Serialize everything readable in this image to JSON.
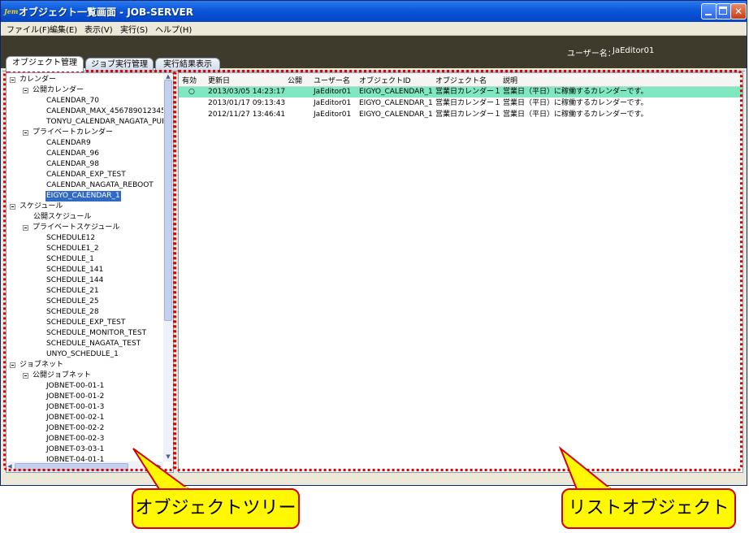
{
  "window": {
    "app_icon": "Jem",
    "title": "オブジェクト一覧画面 - JOB-SERVER"
  },
  "menu": [
    "ファイル(F)",
    "編集(E)",
    "表示(V)",
    "実行(S)",
    "ヘルプ(H)"
  ],
  "header": {
    "user_label": "ユーザー名：",
    "user_name": "JaEditor01"
  },
  "tabs": [
    "オブジェクト管理",
    "ジョブ実行管理",
    "実行結果表示"
  ],
  "tree": [
    {
      "label": "カレンダー",
      "level": 0,
      "expander": true
    },
    {
      "label": "公開カレンダー",
      "level": 1,
      "expander": true
    },
    {
      "label": "CALENDAR_70",
      "level": 2
    },
    {
      "label": "CALENDAR_MAX_456789012345(",
      "level": 2
    },
    {
      "label": "TONYU_CALENDAR_NAGATA_PUE",
      "level": 2
    },
    {
      "label": "プライベートカレンダー",
      "level": 1,
      "expander": true
    },
    {
      "label": "CALENDAR9",
      "level": 2
    },
    {
      "label": "CALENDAR_96",
      "level": 2
    },
    {
      "label": "CALENDAR_98",
      "level": 2
    },
    {
      "label": "CALENDAR_EXP_TEST",
      "level": 2
    },
    {
      "label": "CALENDAR_NAGATA_REBOOT",
      "level": 2
    },
    {
      "label": "EIGYO_CALENDAR_1",
      "level": 2,
      "selected": true
    },
    {
      "label": "スケジュール",
      "level": 0,
      "expander": true
    },
    {
      "label": "公開スケジュール",
      "level": 1
    },
    {
      "label": "プライベートスケジュール",
      "level": 1,
      "expander": true
    },
    {
      "label": "SCHEDULE12",
      "level": 2
    },
    {
      "label": "SCHEDULE1_2",
      "level": 2
    },
    {
      "label": "SCHEDULE_1",
      "level": 2
    },
    {
      "label": "SCHEDULE_141",
      "level": 2
    },
    {
      "label": "SCHEDULE_144",
      "level": 2
    },
    {
      "label": "SCHEDULE_21",
      "level": 2
    },
    {
      "label": "SCHEDULE_25",
      "level": 2
    },
    {
      "label": "SCHEDULE_28",
      "level": 2
    },
    {
      "label": "SCHEDULE_EXP_TEST",
      "level": 2
    },
    {
      "label": "SCHEDULE_MONITOR_TEST",
      "level": 2
    },
    {
      "label": "SCHEDULE_NAGATA_TEST",
      "level": 2
    },
    {
      "label": "UNYO_SCHEDULE_1",
      "level": 2
    },
    {
      "label": "ジョブネット",
      "level": 0,
      "expander": true
    },
    {
      "label": "公開ジョブネット",
      "level": 1,
      "expander": true
    },
    {
      "label": "JOBNET-00-01-1",
      "level": 2
    },
    {
      "label": "JOBNET-00-01-2",
      "level": 2
    },
    {
      "label": "JOBNET-00-01-3",
      "level": 2
    },
    {
      "label": "JOBNET-00-02-1",
      "level": 2
    },
    {
      "label": "JOBNET-00-02-2",
      "level": 2
    },
    {
      "label": "JOBNET-00-02-3",
      "level": 2
    },
    {
      "label": "JOBNET-03-03-1",
      "level": 2
    },
    {
      "label": "JOBNET-04-01-1",
      "level": 2
    }
  ],
  "list": {
    "columns": [
      "有効",
      "更新日",
      "公開",
      "ユーザー名",
      "オブジェクトID",
      "オブジェクト名",
      "説明"
    ],
    "rows": [
      {
        "valid": "○",
        "updated": "2013/03/05 14:23:17",
        "public": "",
        "user": "JaEditor01",
        "object_id": "EIGYO_CALENDAR_1",
        "object_name": "営業日カレンダー１",
        "description": "営業日（平日）に稼働するカレンダーです。",
        "selected": true
      },
      {
        "valid": "",
        "updated": "2013/01/17 09:13:43",
        "public": "",
        "user": "JaEditor01",
        "object_id": "EIGYO_CALENDAR_1",
        "object_name": "営業日カレンダー１",
        "description": "営業日（平日）に稼働するカレンダーです。"
      },
      {
        "valid": "",
        "updated": "2012/11/27 13:46:41",
        "public": "",
        "user": "JaEditor01",
        "object_id": "EIGYO_CALENDAR_1",
        "object_name": "営業日カレンダー１",
        "description": "営業日（平日）に稼働するカレンダーです。"
      }
    ]
  },
  "callouts": {
    "tree": "オブジェクトツリー",
    "list": "リストオブジェクト"
  },
  "colors": {
    "title_bar": "#0a57d8",
    "header_band": "#3e3a2c",
    "selected_row": "#7fe8c0",
    "selected_tree": "#316ac5",
    "highlight_dash": "#e00000",
    "callout_fill": "#fff800"
  }
}
